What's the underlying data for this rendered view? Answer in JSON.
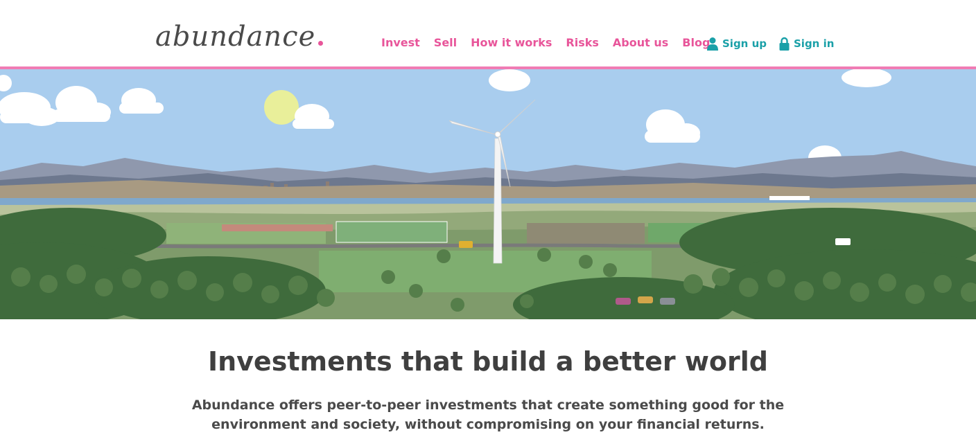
{
  "brand": {
    "logo_text": "abundance",
    "accent_color": "#e8559a",
    "secondary_color": "#1aa0a8"
  },
  "nav": {
    "items": [
      {
        "label": "Invest"
      },
      {
        "label": "Sell"
      },
      {
        "label": "How it works"
      },
      {
        "label": "Risks"
      },
      {
        "label": "About us"
      },
      {
        "label": "Blog"
      }
    ]
  },
  "auth": {
    "sign_up": {
      "label": "Sign up",
      "icon": "user-icon"
    },
    "sign_in": {
      "label": "Sign in",
      "icon": "lock-icon"
    }
  },
  "hero": {
    "illustration": "wind-turbine-landscape-illustration"
  },
  "main": {
    "headline": "Investments that build a better world",
    "subtext_line1": "Abundance offers peer-to-peer investments that create something good for the",
    "subtext_line2": "environment and society, without compromising on your financial returns."
  }
}
